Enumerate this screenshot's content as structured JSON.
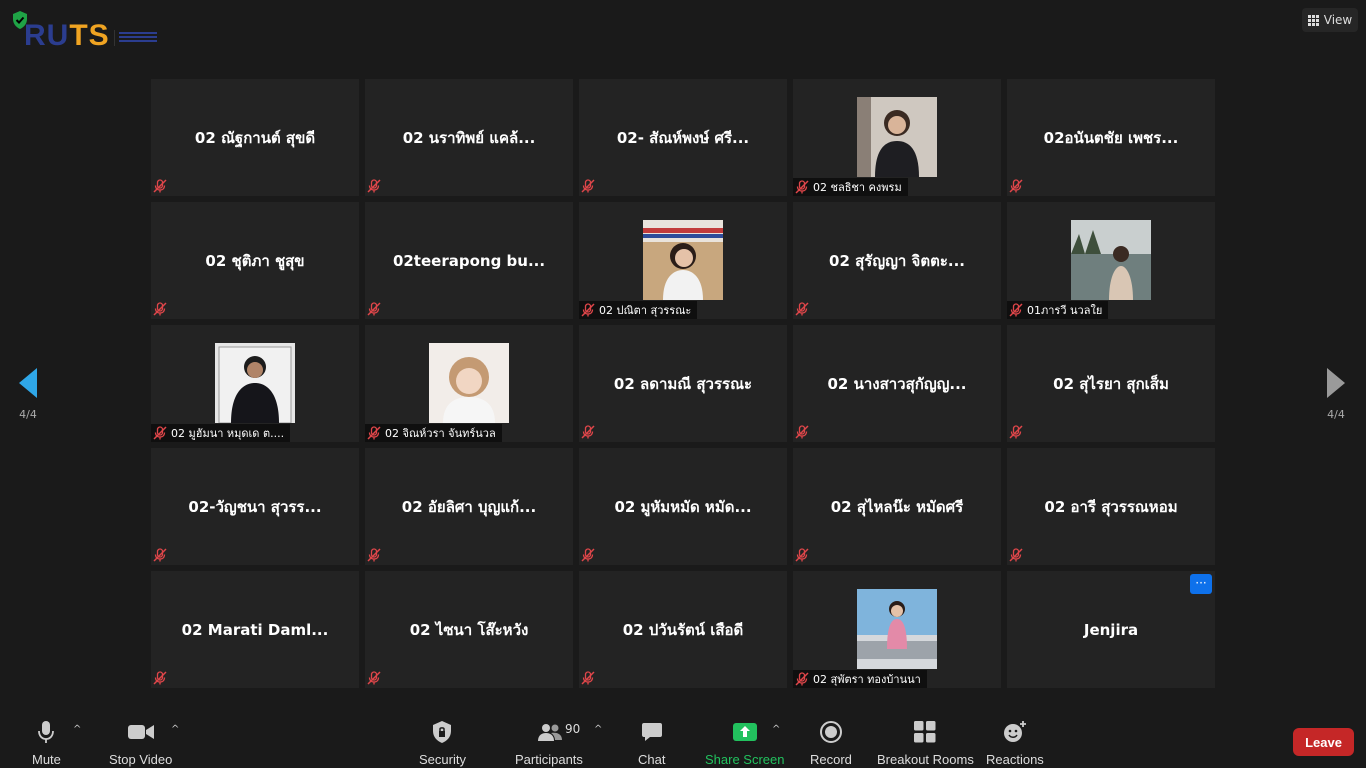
{
  "header": {
    "logo_part1": "RU",
    "logo_part2": "TS",
    "view_label": "View"
  },
  "navigation": {
    "page_left": "4/4",
    "page_right": "4/4"
  },
  "participants": [
    {
      "name": "02 ณัฐกานต์ สุขดี",
      "type": "name"
    },
    {
      "name": "02 นราทิพย์ แคล้...",
      "type": "name"
    },
    {
      "name": "02- สัณห์พงษ์  ศรี...",
      "type": "name"
    },
    {
      "name": "02 ชลธิชา คงพรม",
      "type": "photo",
      "photo": "dark-shirt"
    },
    {
      "name": "02อนันตชัย เพชร...",
      "type": "name"
    },
    {
      "name": "02 ชุติภา ชูสุข",
      "type": "name"
    },
    {
      "name": "02teerapong  bu...",
      "type": "name"
    },
    {
      "name": "02 ปณิตา สุวรรณะ",
      "type": "photo",
      "photo": "outdoor-flags"
    },
    {
      "name": "02 สุรัญญา จิตตะ...",
      "type": "name"
    },
    {
      "name": "01ภารวี นวลใย",
      "type": "photo",
      "photo": "lake"
    },
    {
      "name": "02 มูฮัมนา หมุดเด ต....",
      "type": "photo",
      "photo": "suit-mirror"
    },
    {
      "name": "02 จิณห์วรา จันทร์นวล",
      "type": "photo",
      "photo": "light-portrait"
    },
    {
      "name": "02 ลดามณี สุวรรณะ",
      "type": "name"
    },
    {
      "name": "02 นางสาวสุกัญญ...",
      "type": "name"
    },
    {
      "name": "02 สุไรยา สุกเส็ม",
      "type": "name"
    },
    {
      "name": "02-วัญชนา สุวรร...",
      "type": "name"
    },
    {
      "name": "02 อัยลิศา บุญแก้...",
      "type": "name"
    },
    {
      "name": "02 มูหัมหมัด หมัด...",
      "type": "name"
    },
    {
      "name": "02 สุไหลน๊ะ หมัดศรี",
      "type": "name"
    },
    {
      "name": "02 อารี สุวรรณหอม",
      "type": "name"
    },
    {
      "name": "02  Marati Daml...",
      "type": "name"
    },
    {
      "name": "02 ไซนา โส๊ะหวัง",
      "type": "name"
    },
    {
      "name": "02 ปวันรัตน์ เสือดี",
      "type": "name"
    },
    {
      "name": "02 สุพัตรา ทองบ้านนา",
      "type": "photo",
      "photo": "car-sky"
    },
    {
      "name": "Jenjira",
      "type": "host",
      "more_label": "···"
    }
  ],
  "toolbar": {
    "mute": "Mute",
    "stop_video": "Stop Video",
    "security": "Security",
    "participants": "Participants",
    "participants_count": "90",
    "chat": "Chat",
    "share_screen": "Share Screen",
    "record": "Record",
    "breakout_rooms": "Breakout Rooms",
    "reactions": "Reactions",
    "leave": "Leave",
    "caret": "^"
  },
  "colors": {
    "accent_blue": "#0e71eb",
    "share_green": "#22c15e",
    "leave_red": "#c52727",
    "muted_red": "#e0464a"
  }
}
